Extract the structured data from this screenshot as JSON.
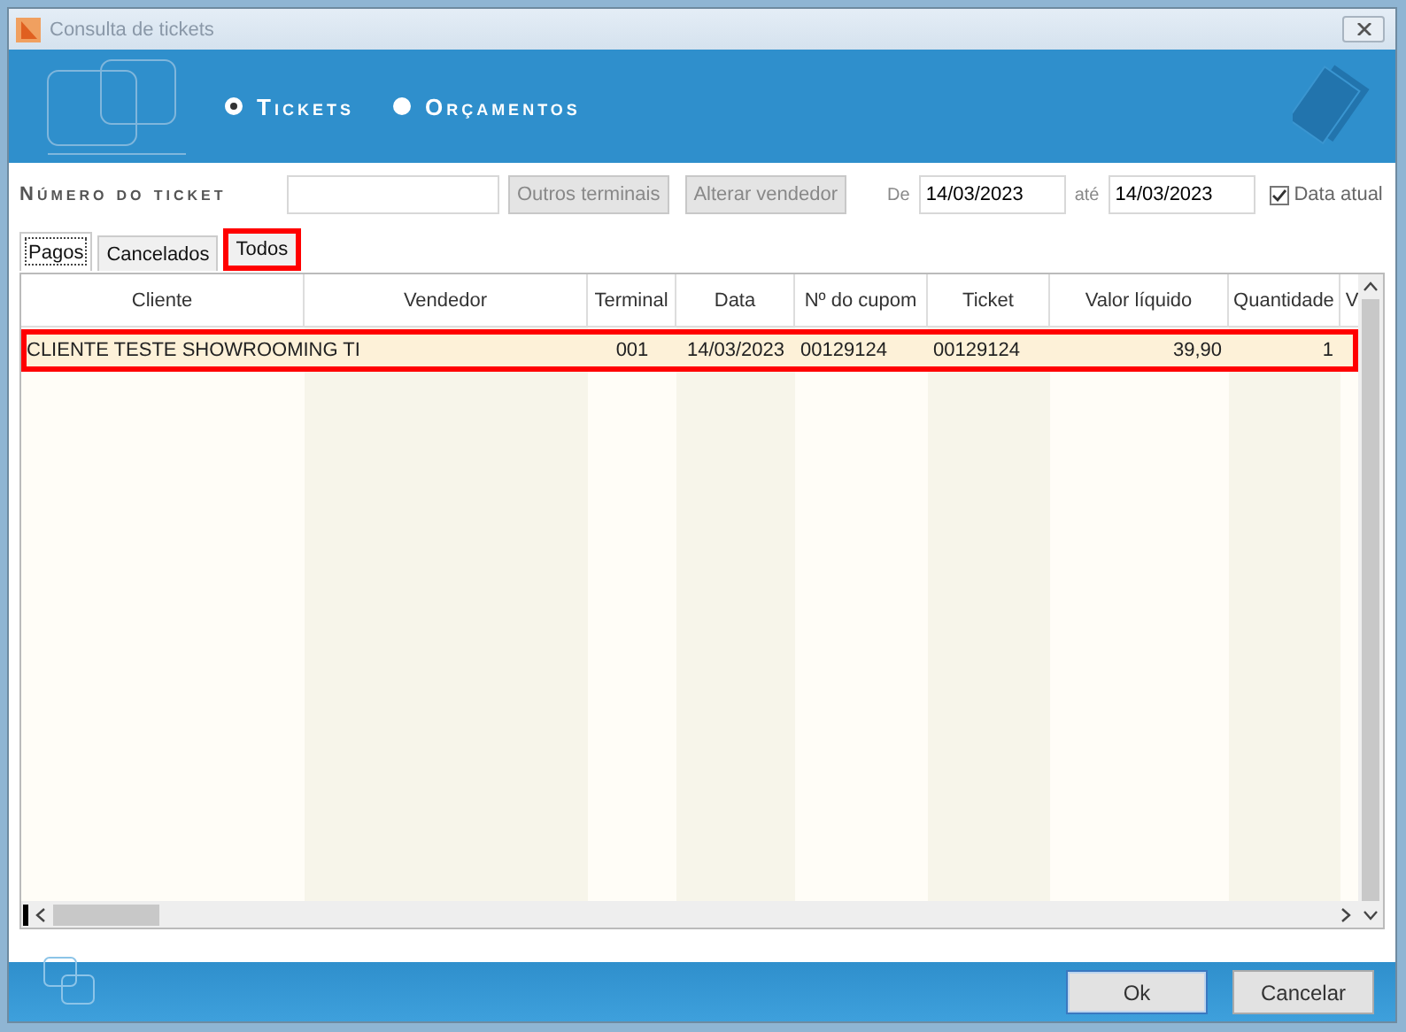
{
  "window": {
    "title": "Consulta de tickets"
  },
  "modes": [
    {
      "label": "Tickets",
      "selected": true
    },
    {
      "label": "Orçamentos",
      "selected": false
    }
  ],
  "filter": {
    "label": "Número do ticket",
    "buttons": [
      "Outros terminais",
      "Alterar vendedor"
    ],
    "from_label": "De",
    "from_value": "14/03/2023",
    "to_label": "até",
    "to_value": "14/03/2023",
    "current_date": {
      "label": "Data atual",
      "checked": true
    }
  },
  "tabs": [
    {
      "label": "Pagos",
      "selected": true,
      "highlighted": false
    },
    {
      "label": "Cancelados",
      "selected": false,
      "highlighted": false
    },
    {
      "label": "Todos",
      "selected": false,
      "highlighted": true
    }
  ],
  "table": {
    "columns": [
      "Cliente",
      "Vendedor",
      "Terminal",
      "Data",
      "Nº do cupom",
      "Ticket",
      "Valor líquido",
      "Quantidade",
      "V"
    ],
    "rows": [
      {
        "selected": true,
        "highlighted": true,
        "cells": [
          "CLIENTE TESTE SHOWROOMING TI",
          "",
          "001",
          "14/03/2023",
          "00129124",
          "00129124",
          "39,90",
          "1",
          ""
        ]
      }
    ]
  },
  "buttons": [
    {
      "label": "Ok",
      "default": true
    },
    {
      "label": "Cancelar",
      "default": false
    }
  ]
}
